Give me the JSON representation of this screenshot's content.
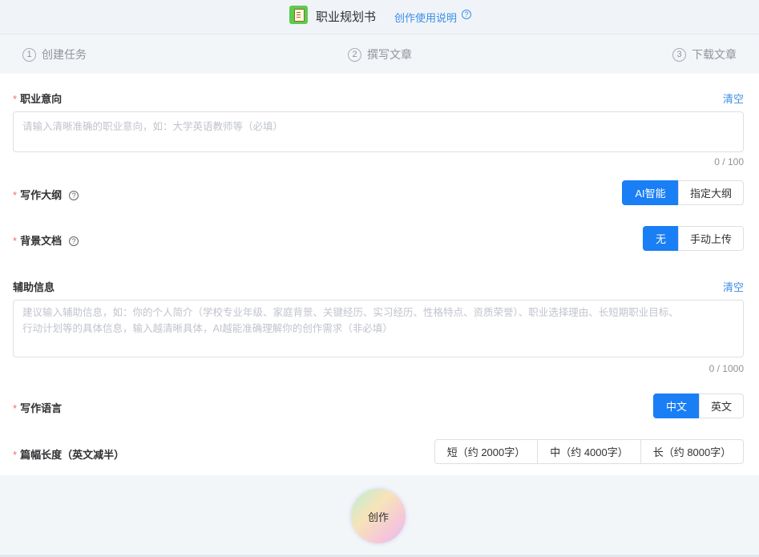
{
  "header": {
    "title": "职业规划书",
    "help_link": "创作使用说明",
    "help_icon": "?"
  },
  "steps": [
    {
      "num": "1",
      "label": "创建任务"
    },
    {
      "num": "2",
      "label": "撰写文章"
    },
    {
      "num": "3",
      "label": "下载文章"
    }
  ],
  "form": {
    "required_mark": "*",
    "career": {
      "label": "职业意向",
      "clear": "清空",
      "placeholder": "请输入清晰准确的职业意向，如：大学英语教师等（必填）",
      "counter": "0 / 100"
    },
    "outline": {
      "label": "写作大纲",
      "help_icon": "?",
      "options": [
        "AI智能",
        "指定大纲"
      ],
      "selected": 0
    },
    "background_doc": {
      "label": "背景文档",
      "help_icon": "?",
      "options": [
        "无",
        "手动上传"
      ],
      "selected": 0
    },
    "aux_info": {
      "label": "辅助信息",
      "clear": "清空",
      "placeholder_line1": "建议输入辅助信息，如：你的个人简介（学校专业年级、家庭背景、关键经历、实习经历、性格特点、资质荣誉）、职业选择理由、长短期职业目标、",
      "placeholder_line2": "行动计划等的具体信息，输入越清晰具体，AI越能准确理解你的创作需求（非必填）",
      "counter": "0 / 1000"
    },
    "language": {
      "label": "写作语言",
      "options": [
        "中文",
        "英文"
      ],
      "selected": 0
    },
    "length": {
      "label": "篇幅长度（英文减半）",
      "options": [
        "短（约 2000字）",
        "中（约 4000字）",
        "长（约 8000字）"
      ],
      "selected": -1
    }
  },
  "create_button": "创作",
  "colors": {
    "accent": "#1a7ef5",
    "link": "#3a8ee6",
    "required": "#f56c6c"
  }
}
